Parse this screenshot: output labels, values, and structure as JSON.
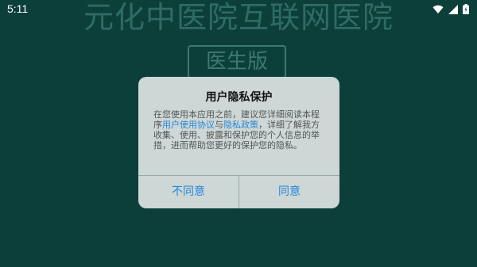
{
  "status_bar": {
    "time": "5:11",
    "icons": [
      "wifi-icon",
      "signal-icon",
      "battery-icon"
    ]
  },
  "background": {
    "title": "元化中医院互联网医院",
    "badge": "医生版"
  },
  "dialog": {
    "title": "用户隐私保护",
    "body": {
      "part1": "在您使用本应用之前，建议您详细阅读本程序",
      "link1": "用户使用协议",
      "part2": "与",
      "link2": "隐私政策",
      "part3": "，详细了解我方收集、使用、披露和保护您的个人信息的举措，进而帮助您更好的保护您的隐私。"
    },
    "buttons": {
      "disagree": "不同意",
      "agree": "同意"
    }
  },
  "colors": {
    "background": "#0d3f3a",
    "dialog": "#ccd7d6",
    "link": "#2a86d8"
  }
}
